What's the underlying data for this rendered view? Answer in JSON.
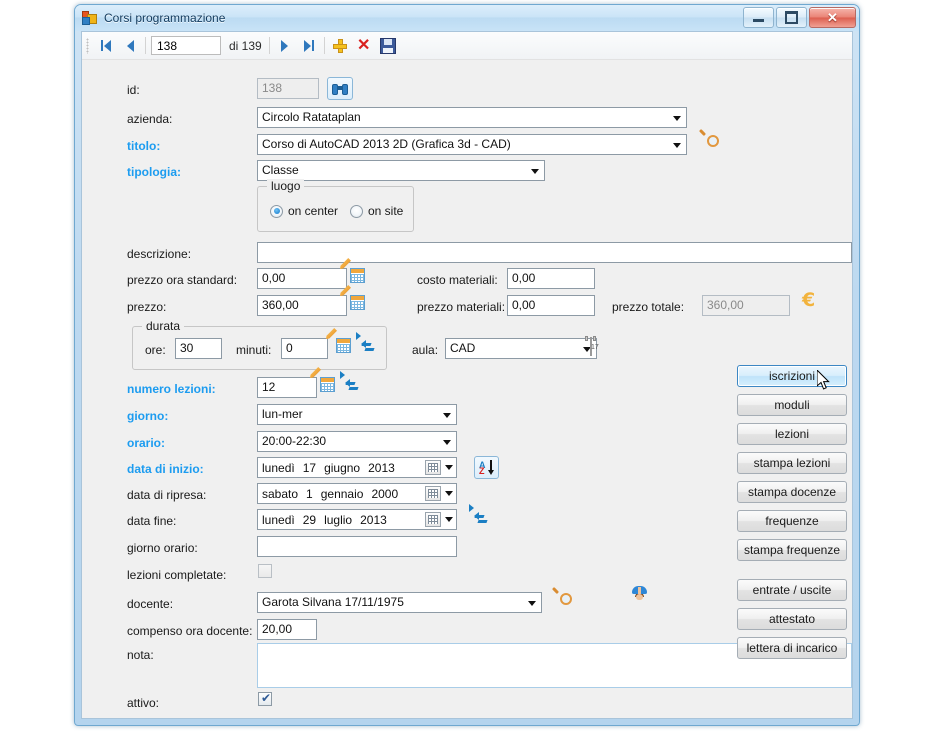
{
  "window": {
    "title": "Corsi programmazione",
    "icon": "vb-form-icon",
    "controls": {
      "minimize": "minimize-button",
      "maximize": "maximize-button",
      "close": "close-button"
    }
  },
  "toolbar": {
    "first_label": "first-record",
    "prev_label": "previous-record",
    "record_value": "138",
    "count_label": "di 139",
    "next_label": "next-record",
    "last_label": "last-record",
    "add_label": "add-record",
    "delete_label": "delete-record",
    "save_label": "save-record"
  },
  "form": {
    "id": {
      "label": "id:",
      "value": "138",
      "readonly": true,
      "search_icon": "binoculars-icon"
    },
    "azienda": {
      "label": "azienda:",
      "value": "Circolo Ratataplan"
    },
    "titolo": {
      "label": "titolo:",
      "value": "Corso di AutoCAD 2013 2D (Grafica 3d - CAD)",
      "highlight": true
    },
    "tipologia": {
      "label": "tipologia:",
      "value": "Classe",
      "highlight": true
    },
    "luogo": {
      "legend": "luogo",
      "options": [
        {
          "label": "on center",
          "selected": true
        },
        {
          "label": "on site",
          "selected": false
        }
      ]
    },
    "descrizione": {
      "label": "descrizione:",
      "value": ""
    },
    "prezzo_ora_standard": {
      "label": "prezzo ora standard:",
      "value": "0,00"
    },
    "costo_materiali": {
      "label": "costo materiali:",
      "value": "0,00"
    },
    "prezzo": {
      "label": "prezzo:",
      "value": "360,00"
    },
    "prezzo_materiali": {
      "label": "prezzo materiali:",
      "value": "0,00"
    },
    "prezzo_totale": {
      "label": "prezzo totale:",
      "value": "360,00",
      "readonly": true
    },
    "durata": {
      "legend": "durata",
      "ore": {
        "label": "ore:",
        "value": "30"
      },
      "minuti": {
        "label": "minuti:",
        "value": "0"
      }
    },
    "aula": {
      "label": "aula:",
      "value": "CAD"
    },
    "numero_lezioni": {
      "label": "numero lezioni:",
      "value": "12",
      "highlight": true
    },
    "giorno": {
      "label": "giorno:",
      "value": "lun-mer",
      "highlight": true
    },
    "orario": {
      "label": "orario:",
      "value": "20:00-22:30",
      "highlight": true
    },
    "data_inizio": {
      "label": "data di inizio:",
      "highlight": true,
      "weekday": "lunedì",
      "day": "17",
      "month": "giugno",
      "year": "2013"
    },
    "data_ripresa": {
      "label": "data di ripresa:",
      "weekday": "sabato",
      "day": "1",
      "month": "gennaio",
      "year": "2000"
    },
    "data_fine": {
      "label": "data fine:",
      "weekday": "lunedì",
      "day": "29",
      "month": "luglio",
      "year": "2013"
    },
    "giorno_orario": {
      "label": "giorno orario:",
      "value": ""
    },
    "lezioni_completate": {
      "label": "lezioni completate:",
      "checked": false,
      "disabled": true
    },
    "docente": {
      "label": "docente:",
      "value": "Garota Silvana 17/11/1975"
    },
    "compenso_ora_docente": {
      "label": "compenso ora docente:",
      "value": "20,00"
    },
    "nota": {
      "label": "nota:",
      "value": ""
    },
    "attivo": {
      "label": "attivo:",
      "checked": true,
      "check_glyph": "✔"
    }
  },
  "side_buttons": [
    {
      "label": "iscrizioni",
      "hovered": true
    },
    {
      "label": "moduli",
      "hovered": false
    },
    {
      "label": "lezioni",
      "hovered": false
    },
    {
      "label": "stampa lezioni",
      "hovered": false
    },
    {
      "label": "stampa docenze",
      "hovered": false
    },
    {
      "label": "frequenze",
      "hovered": false
    },
    {
      "label": "stampa frequenze",
      "hovered": false
    },
    {
      "label": "entrate / uscite",
      "hovered": false
    },
    {
      "label": "attestato",
      "hovered": false
    },
    {
      "label": "lettera di incarico",
      "hovered": false
    }
  ],
  "colors": {
    "highlight_label": "#1c9cf0",
    "window_frame": "#b4d4ee",
    "form_background": "#f0f0f0",
    "euro_symbol": "#f2b33d",
    "accent_orange": "#e2983f"
  }
}
